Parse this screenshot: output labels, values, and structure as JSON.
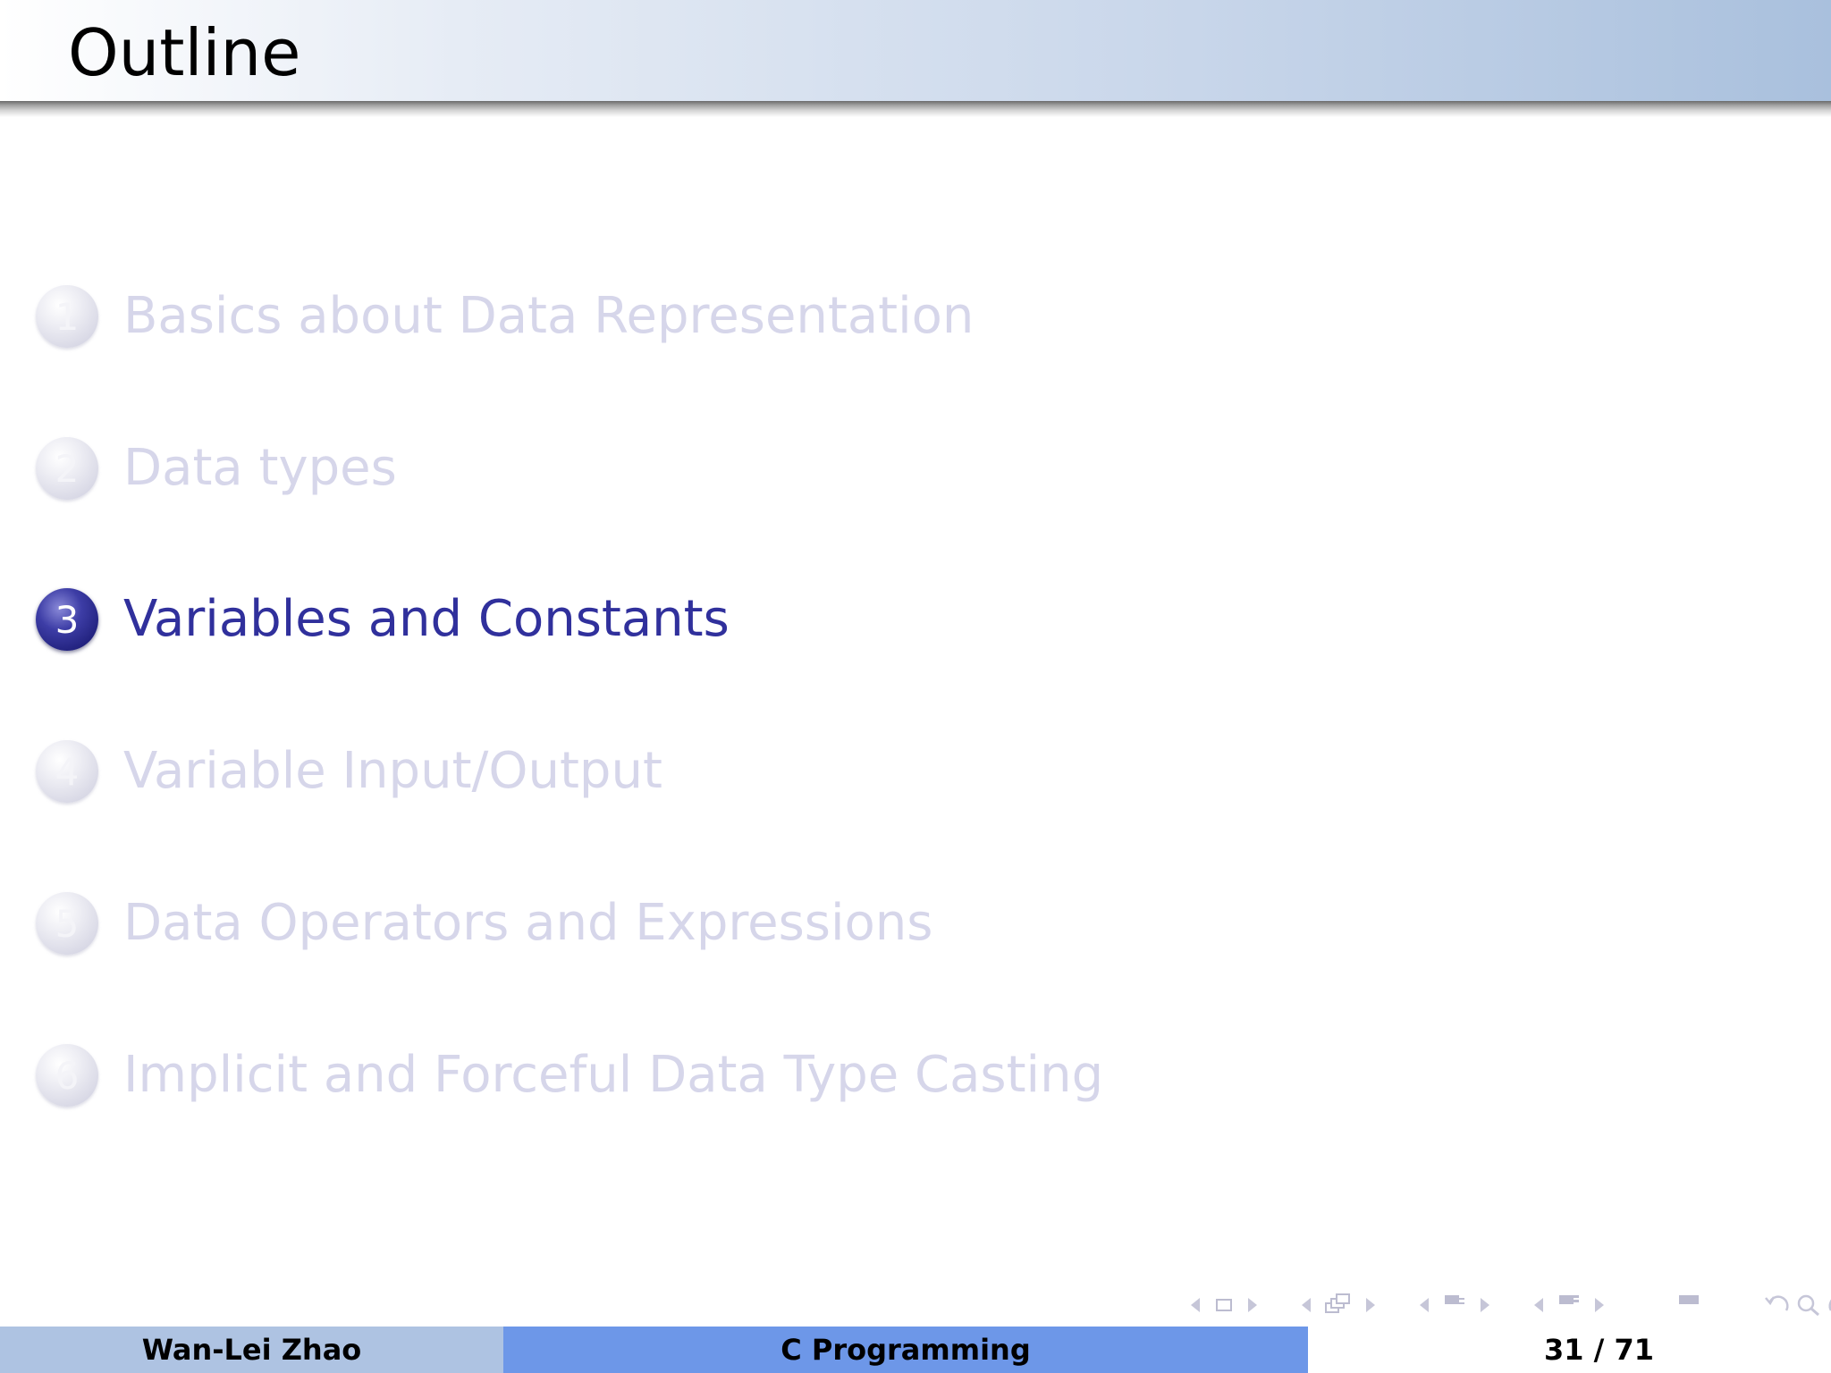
{
  "slide": {
    "title": "Outline"
  },
  "toc": {
    "items": [
      {
        "number": "1",
        "label": "Basics about Data Representation",
        "state": "dim"
      },
      {
        "number": "2",
        "label": "Data types",
        "state": "dim"
      },
      {
        "number": "3",
        "label": "Variables and Constants",
        "state": "active"
      },
      {
        "number": "4",
        "label": "Variable Input/Output",
        "state": "dim"
      },
      {
        "number": "5",
        "label": "Data Operators and Expressions",
        "state": "dim"
      },
      {
        "number": "6",
        "label": "Implicit and Forceful Data Type Casting",
        "state": "dim"
      }
    ]
  },
  "footer": {
    "author": "Wan-Lei Zhao",
    "course": "C Programming",
    "page": "31 / 71"
  },
  "navigation": {
    "icons": [
      "slide-prev-icon",
      "slide-icon",
      "slide-next-icon",
      "frame-prev-icon",
      "frames-icon",
      "frame-next-icon",
      "subsection-prev-icon",
      "subsection-icon",
      "subsection-next-icon",
      "section-prev-icon",
      "section-icon",
      "section-next-icon",
      "toc-icon",
      "undo-icon",
      "search-icon",
      "redo-icon"
    ]
  },
  "colors": {
    "active": "#30309c",
    "dim": "#d6d6ea",
    "footer_author_bg": "#aec3e2",
    "footer_title_bg": "#6d97e8"
  }
}
